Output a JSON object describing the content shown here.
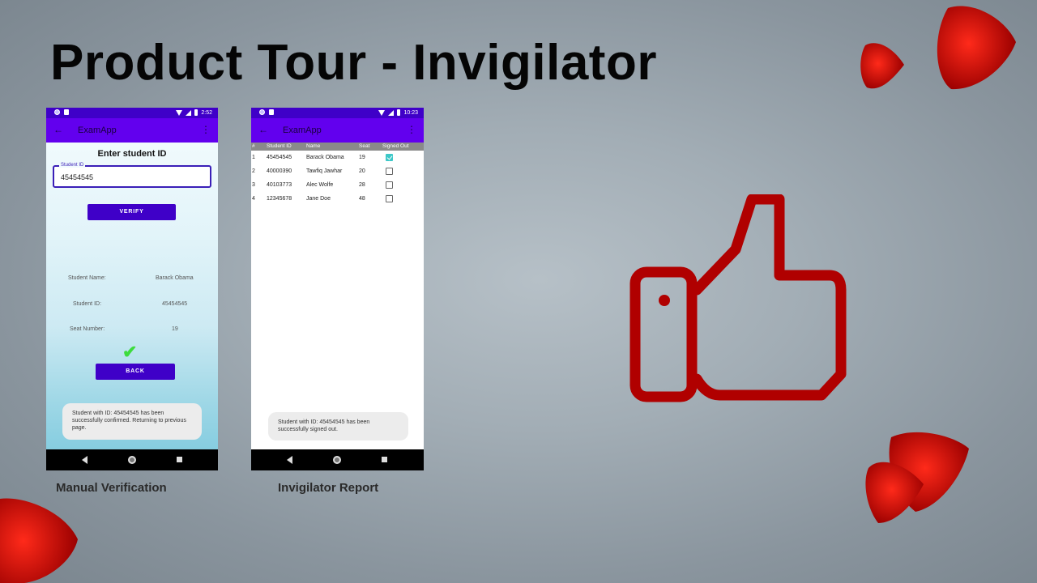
{
  "slide": {
    "title": "Product Tour - Invigilator"
  },
  "colors": {
    "status_bar": "#3f00c8",
    "app_bar": "#6200ee",
    "button": "#3f00c8",
    "thumb_icon": "#b00000",
    "blob": "#d40000",
    "check_green": "#3ddc3d",
    "checkbox_teal": "#3dc8c8"
  },
  "phone1": {
    "status": {
      "time": "2:52"
    },
    "app_title": "ExamApp",
    "heading": "Enter student ID",
    "field": {
      "label": "Student ID",
      "value": "45454545"
    },
    "verify_label": "VERIFY",
    "info": [
      {
        "label": "Student Name:",
        "value": "Barack Obama"
      },
      {
        "label": "Student ID:",
        "value": "45454545"
      },
      {
        "label": "Seat Number:",
        "value": "19"
      }
    ],
    "back_label": "BACK",
    "toast": "Student with ID: 45454545 has been successfully confirmed. Returning to previous page.",
    "caption": "Manual Verification"
  },
  "phone2": {
    "status": {
      "time": "10:23"
    },
    "app_title": "ExamApp",
    "columns": [
      "#",
      "Student ID",
      "Name",
      "Seat",
      "Signed Out"
    ],
    "rows": [
      {
        "num": "1",
        "id": "45454545",
        "name": "Barack Obama",
        "seat": "19",
        "signed_out": true
      },
      {
        "num": "2",
        "id": "40000390",
        "name": "Tawfiq Jawhar",
        "seat": "20",
        "signed_out": false
      },
      {
        "num": "3",
        "id": "40103773",
        "name": "Alec Wolfe",
        "seat": "28",
        "signed_out": false
      },
      {
        "num": "4",
        "id": "12345678",
        "name": "Jane Doe",
        "seat": "48",
        "signed_out": false
      }
    ],
    "toast": "Student with ID: 45454545 has been successfully signed out.",
    "caption": "Invigilator Report"
  },
  "icons": {
    "thumb": "thumbs-up-icon",
    "check": "checkmark-icon"
  }
}
